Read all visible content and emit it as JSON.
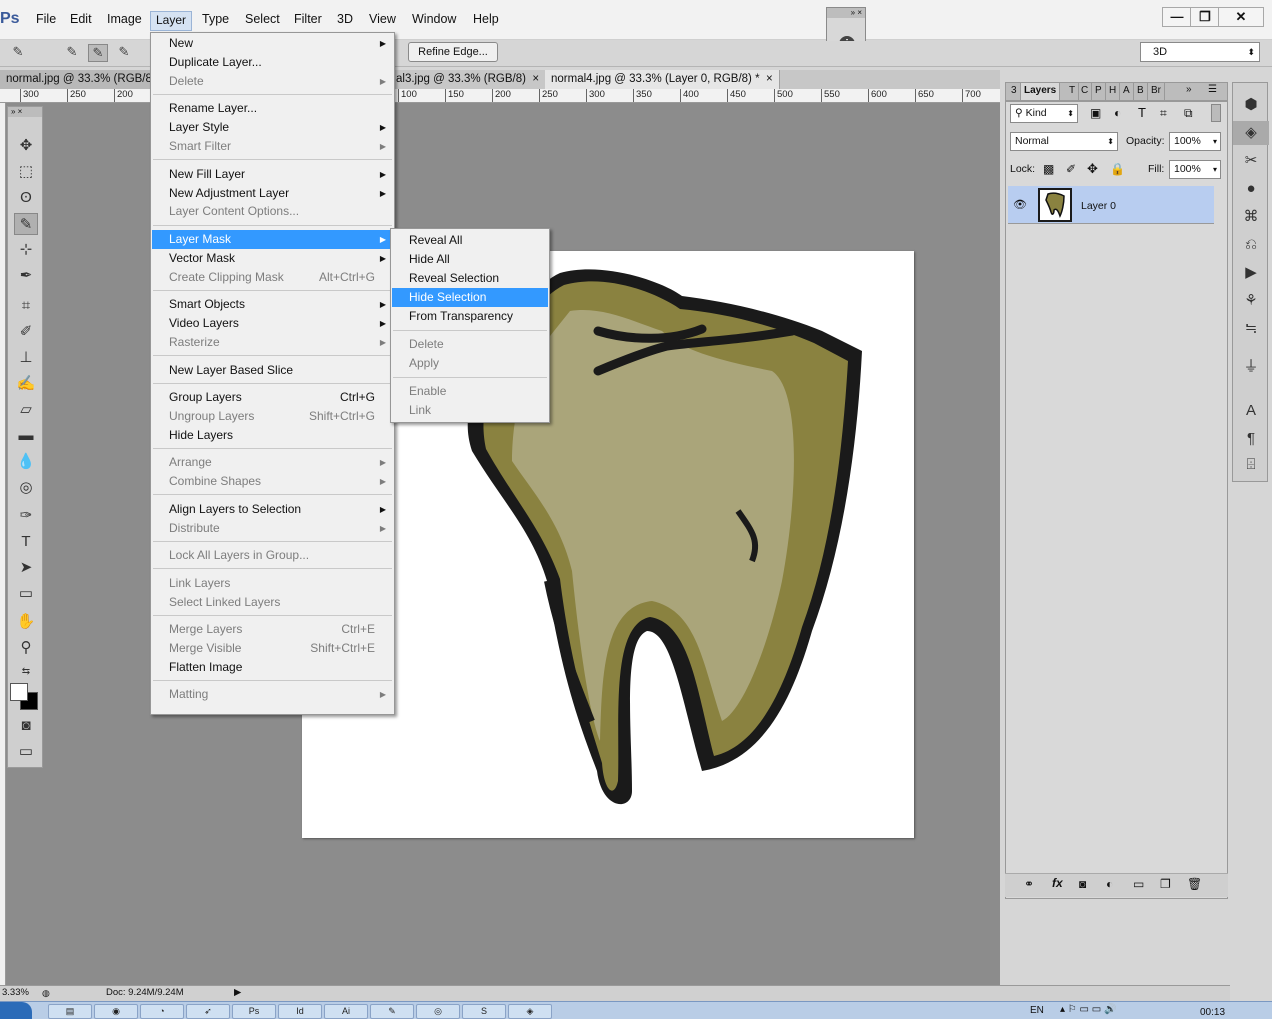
{
  "app": {
    "logo": "Ps"
  },
  "menubar": {
    "items": [
      "File",
      "Edit",
      "Image",
      "Layer",
      "Type",
      "Select",
      "Filter",
      "3D",
      "View",
      "Window",
      "Help"
    ]
  },
  "window_controls": {
    "minimize": "—",
    "restore": "❐",
    "close": "✕"
  },
  "options_bar": {
    "refine_edge": "Refine Edge...",
    "workspace": "3D"
  },
  "tabs": [
    "normal.jpg @ 33.3% (RGB/8)",
    "al3.jpg @ 33.3% (RGB/8)",
    "normal4.jpg @ 33.3% (Layer 0, RGB/8) *"
  ],
  "tab_close": "×",
  "ruler": [
    "300",
    "250",
    "200",
    "100",
    "150",
    "200",
    "250",
    "300",
    "350",
    "400",
    "450",
    "500",
    "550",
    "600",
    "650",
    "700"
  ],
  "layer_menu": {
    "groups": [
      [
        {
          "label": "New",
          "sub": true
        },
        {
          "label": "Duplicate Layer..."
        },
        {
          "label": "Delete",
          "disabled": true,
          "sub": true
        }
      ],
      [
        {
          "label": "Rename Layer..."
        },
        {
          "label": "Layer Style",
          "sub": true
        },
        {
          "label": "Smart Filter",
          "disabled": true,
          "sub": true
        }
      ],
      [
        {
          "label": "New Fill Layer",
          "sub": true
        },
        {
          "label": "New Adjustment Layer",
          "sub": true
        },
        {
          "label": "Layer Content Options...",
          "disabled": true
        }
      ],
      [
        {
          "label": "Layer Mask",
          "sub": true,
          "highlight": true
        },
        {
          "label": "Vector Mask",
          "sub": true
        },
        {
          "label": "Create Clipping Mask",
          "disabled": true,
          "shortcut": "Alt+Ctrl+G"
        }
      ],
      [
        {
          "label": "Smart Objects",
          "sub": true
        },
        {
          "label": "Video Layers",
          "sub": true
        },
        {
          "label": "Rasterize",
          "disabled": true,
          "sub": true
        }
      ],
      [
        {
          "label": "New Layer Based Slice"
        }
      ],
      [
        {
          "label": "Group Layers",
          "shortcut": "Ctrl+G"
        },
        {
          "label": "Ungroup Layers",
          "disabled": true,
          "shortcut": "Shift+Ctrl+G"
        },
        {
          "label": "Hide Layers"
        }
      ],
      [
        {
          "label": "Arrange",
          "disabled": true,
          "sub": true
        },
        {
          "label": "Combine Shapes",
          "disabled": true,
          "sub": true
        }
      ],
      [
        {
          "label": "Align Layers to Selection",
          "sub": true
        },
        {
          "label": "Distribute",
          "disabled": true,
          "sub": true
        }
      ],
      [
        {
          "label": "Lock All Layers in Group...",
          "disabled": true
        }
      ],
      [
        {
          "label": "Link Layers",
          "disabled": true
        },
        {
          "label": "Select Linked Layers",
          "disabled": true
        }
      ],
      [
        {
          "label": "Merge Layers",
          "disabled": true,
          "shortcut": "Ctrl+E"
        },
        {
          "label": "Merge Visible",
          "disabled": true,
          "shortcut": "Shift+Ctrl+E"
        },
        {
          "label": "Flatten Image"
        }
      ],
      [
        {
          "label": "Matting",
          "disabled": true,
          "sub": true
        }
      ]
    ]
  },
  "mask_menu": {
    "groups": [
      [
        {
          "label": "Reveal All"
        },
        {
          "label": "Hide All"
        },
        {
          "label": "Reveal Selection"
        },
        {
          "label": "Hide Selection",
          "highlight": true
        },
        {
          "label": "From Transparency"
        }
      ],
      [
        {
          "label": "Delete",
          "disabled": true
        },
        {
          "label": "Apply",
          "disabled": true
        }
      ],
      [
        {
          "label": "Enable",
          "disabled": true
        },
        {
          "label": "Link",
          "disabled": true
        }
      ]
    ]
  },
  "layers_panel": {
    "tabs": [
      "3",
      "Layers",
      "T",
      "C",
      "P",
      "H",
      "A",
      "B",
      "Br"
    ],
    "kind": "Kind",
    "blend_mode": "Normal",
    "opacity_label": "Opacity:",
    "opacity": "100%",
    "lock_label": "Lock:",
    "fill_label": "Fill:",
    "fill": "100%",
    "layer_name": "Layer 0"
  },
  "status": {
    "zoom": "3.33%",
    "doc": "Doc: 9.24M/9.24M"
  },
  "taskbar": {
    "apps": [
      "",
      "",
      "",
      "",
      "Ps",
      "Id",
      "Ai",
      "",
      "",
      "S",
      ""
    ],
    "lang": "EN",
    "time": "00:13"
  },
  "colors": {
    "highlight": "#3399ff",
    "tooth_dark": "#8a8240",
    "tooth_light": "#aaa57a"
  }
}
